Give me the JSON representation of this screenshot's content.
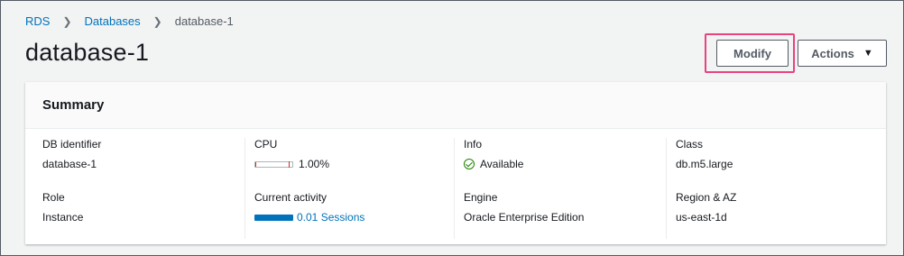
{
  "breadcrumb": {
    "items": [
      "RDS",
      "Databases",
      "database-1"
    ]
  },
  "page": {
    "title": "database-1"
  },
  "toolbar": {
    "modify_label": "Modify",
    "actions_label": "Actions"
  },
  "summary": {
    "title": "Summary",
    "db_identifier": {
      "label": "DB identifier",
      "value": "database-1"
    },
    "role": {
      "label": "Role",
      "value": "Instance"
    },
    "cpu": {
      "label": "CPU",
      "value": "1.00%",
      "fraction": 0.01
    },
    "current_activity": {
      "label": "Current activity",
      "value": "0.01 Sessions"
    },
    "info": {
      "label": "Info",
      "value": "Available",
      "status_color": "#1d8102"
    },
    "engine": {
      "label": "Engine",
      "value": "Oracle Enterprise Edition"
    },
    "class": {
      "label": "Class",
      "value": "db.m5.large"
    },
    "region_az": {
      "label": "Region & AZ",
      "value": "us-east-1d"
    }
  },
  "colors": {
    "link": "#0073bb",
    "highlight": "#e8437f",
    "available": "#1d8102"
  }
}
